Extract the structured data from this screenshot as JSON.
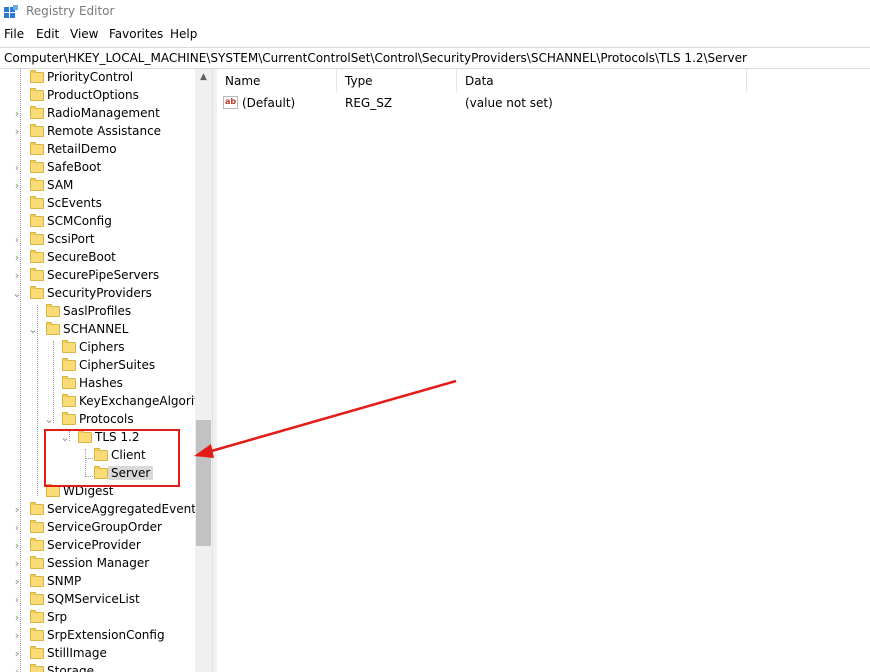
{
  "window": {
    "title": "Registry Editor",
    "icon": "registry-editor-icon"
  },
  "menu": [
    "File",
    "Edit",
    "View",
    "Favorites",
    "Help"
  ],
  "address": "Computer\\HKEY_LOCAL_MACHINE\\SYSTEM\\CurrentControlSet\\Control\\SecurityProviders\\SCHANNEL\\Protocols\\TLS 1.2\\Server",
  "tree": [
    {
      "label": "PriorityControl",
      "chev": ""
    },
    {
      "label": "ProductOptions",
      "chev": ""
    },
    {
      "label": "RadioManagement",
      "chev": "›"
    },
    {
      "label": "Remote Assistance",
      "chev": "›"
    },
    {
      "label": "RetailDemo",
      "chev": ""
    },
    {
      "label": "SafeBoot",
      "chev": "›"
    },
    {
      "label": "SAM",
      "chev": "›"
    },
    {
      "label": "ScEvents",
      "chev": ""
    },
    {
      "label": "SCMConfig",
      "chev": ""
    },
    {
      "label": "ScsiPort",
      "chev": "›"
    },
    {
      "label": "SecureBoot",
      "chev": "›"
    },
    {
      "label": "SecurePipeServers",
      "chev": "›"
    },
    {
      "label": "SecurityProviders",
      "chev": "⌄"
    },
    {
      "label": "SaslProfiles",
      "chev": ""
    },
    {
      "label": "SCHANNEL",
      "chev": "⌄"
    },
    {
      "label": "Ciphers",
      "chev": ""
    },
    {
      "label": "CipherSuites",
      "chev": ""
    },
    {
      "label": "Hashes",
      "chev": ""
    },
    {
      "label": "KeyExchangeAlgorithms",
      "chev": ""
    },
    {
      "label": "Protocols",
      "chev": "⌄"
    },
    {
      "label": "TLS 1.2",
      "chev": "⌄"
    },
    {
      "label": "Client",
      "chev": ""
    },
    {
      "label": "Server",
      "chev": ""
    },
    {
      "label": "WDigest",
      "chev": ""
    },
    {
      "label": "ServiceAggregatedEvents",
      "chev": "›"
    },
    {
      "label": "ServiceGroupOrder",
      "chev": "›"
    },
    {
      "label": "ServiceProvider",
      "chev": "›"
    },
    {
      "label": "Session Manager",
      "chev": "›"
    },
    {
      "label": "SNMP",
      "chev": "›"
    },
    {
      "label": "SQMServiceList",
      "chev": "›"
    },
    {
      "label": "Srp",
      "chev": "›"
    },
    {
      "label": "SrpExtensionConfig",
      "chev": "›"
    },
    {
      "label": "StillImage",
      "chev": "›"
    },
    {
      "label": "Storage",
      "chev": "›"
    }
  ],
  "list": {
    "columns": [
      "Name",
      "Type",
      "Data"
    ],
    "rows": [
      {
        "name": "(Default)",
        "type": "REG_SZ",
        "data": "(value not set)",
        "icon": "ab-string-icon",
        "icon_text": "ab"
      }
    ]
  },
  "colors": {
    "highlight": "#e41b17",
    "folder": "#f9dc78",
    "selection": "#d9d9d9"
  }
}
